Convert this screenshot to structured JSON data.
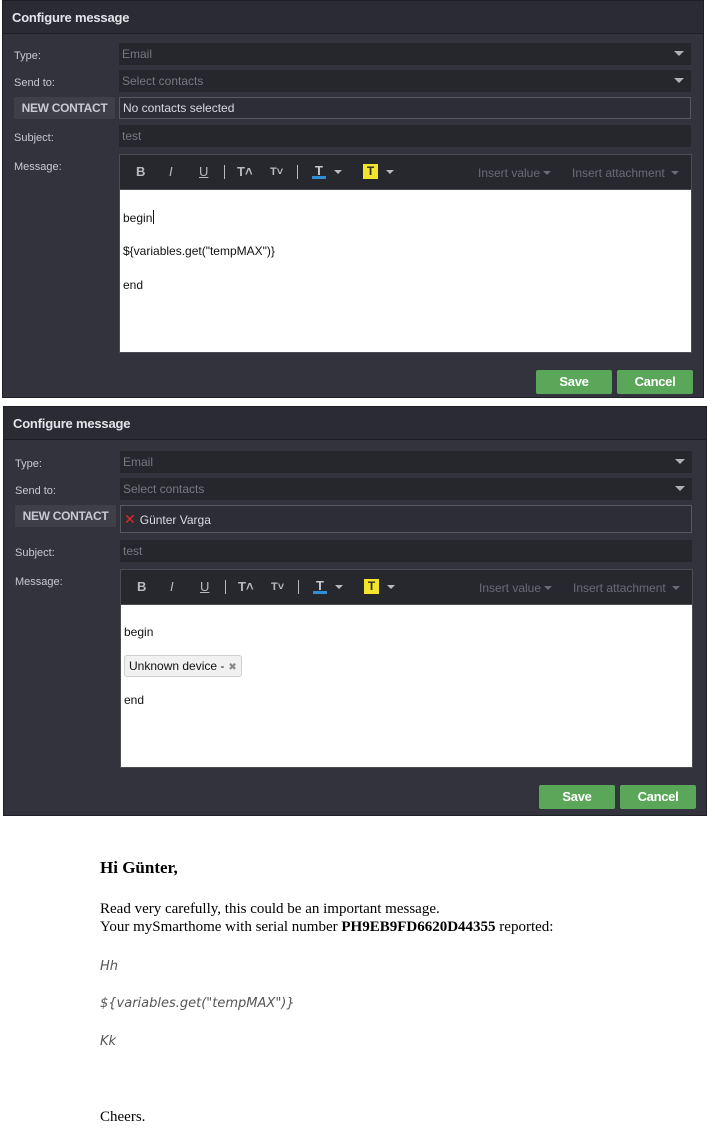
{
  "dialog1": {
    "title": "Configure message",
    "type_label": "Type:",
    "type_value": "Email",
    "sendto_label": "Send to:",
    "sendto_placeholder": "Select contacts",
    "new_contact": "NEW CONTACT",
    "contacts_value": "No contacts selected",
    "subject_label": "Subject:",
    "subject_value": "test",
    "message_label": "Message:",
    "toolbar": {
      "bold": "B",
      "italic": "I",
      "underline": "U",
      "font_up": "T˄",
      "font_down": "T˅",
      "text_color": "T",
      "highlight": "T",
      "insert_value": "Insert value",
      "insert_attachment": "Insert attachment"
    },
    "body_lines": [
      "begin",
      "${variables.get(\"tempMAX\")}",
      "end"
    ],
    "save": "Save",
    "cancel": "Cancel"
  },
  "dialog2": {
    "title": "Configure message",
    "type_label": "Type:",
    "type_value": "Email",
    "sendto_label": "Send to:",
    "sendto_placeholder": "Select contacts",
    "new_contact": "NEW CONTACT",
    "contact_name": "Günter Varga",
    "subject_label": "Subject:",
    "subject_value": "test",
    "message_label": "Message:",
    "toolbar": {
      "bold": "B",
      "italic": "I",
      "underline": "U",
      "font_up": "T˄",
      "font_down": "T˅",
      "text_color": "T",
      "highlight": "T",
      "insert_value": "Insert value",
      "insert_attachment": "Insert attachment"
    },
    "body_line1": "begin",
    "chip_text": "Unknown device -",
    "body_line3": "end",
    "save": "Save",
    "cancel": "Cancel"
  },
  "email": {
    "greeting": "Hi Günter,",
    "line1": "Read very carefully, this could be an important message.",
    "line2_prefix": "Your mySmarthome with serial number ",
    "serial": "PH9EB9FD6620D44355",
    "line2_suffix": " reported:",
    "italic1": "Hh",
    "italic2": "${variables.get(\"tempMAX\")}",
    "italic3": "Kk",
    "closing": "Cheers."
  },
  "colors": {
    "dialog_bg": "#32333c",
    "button_green": "#5aa75a",
    "highlight_yellow": "#f2e52a",
    "text_color_underline": "#2e8fd6",
    "remove_red": "#e02a2a"
  }
}
